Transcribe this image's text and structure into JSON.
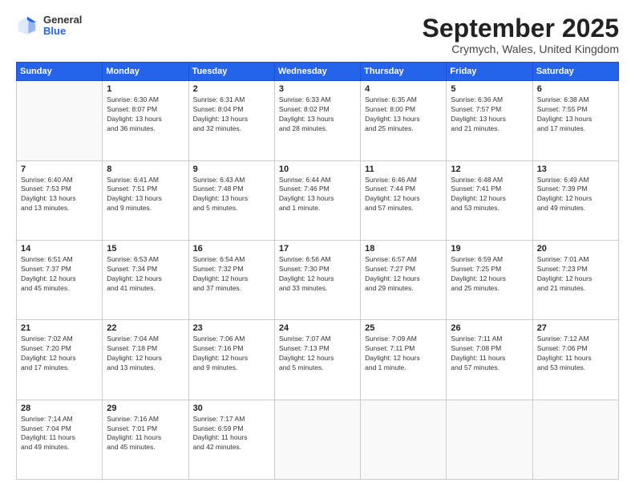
{
  "header": {
    "logo": {
      "general": "General",
      "blue": "Blue"
    },
    "title": "September 2025",
    "location": "Crymych, Wales, United Kingdom"
  },
  "weekdays": [
    "Sunday",
    "Monday",
    "Tuesday",
    "Wednesday",
    "Thursday",
    "Friday",
    "Saturday"
  ],
  "weeks": [
    [
      {
        "day": "",
        "info": ""
      },
      {
        "day": "1",
        "info": "Sunrise: 6:30 AM\nSunset: 8:07 PM\nDaylight: 13 hours\nand 36 minutes."
      },
      {
        "day": "2",
        "info": "Sunrise: 6:31 AM\nSunset: 8:04 PM\nDaylight: 13 hours\nand 32 minutes."
      },
      {
        "day": "3",
        "info": "Sunrise: 6:33 AM\nSunset: 8:02 PM\nDaylight: 13 hours\nand 28 minutes."
      },
      {
        "day": "4",
        "info": "Sunrise: 6:35 AM\nSunset: 8:00 PM\nDaylight: 13 hours\nand 25 minutes."
      },
      {
        "day": "5",
        "info": "Sunrise: 6:36 AM\nSunset: 7:57 PM\nDaylight: 13 hours\nand 21 minutes."
      },
      {
        "day": "6",
        "info": "Sunrise: 6:38 AM\nSunset: 7:55 PM\nDaylight: 13 hours\nand 17 minutes."
      }
    ],
    [
      {
        "day": "7",
        "info": "Sunrise: 6:40 AM\nSunset: 7:53 PM\nDaylight: 13 hours\nand 13 minutes."
      },
      {
        "day": "8",
        "info": "Sunrise: 6:41 AM\nSunset: 7:51 PM\nDaylight: 13 hours\nand 9 minutes."
      },
      {
        "day": "9",
        "info": "Sunrise: 6:43 AM\nSunset: 7:48 PM\nDaylight: 13 hours\nand 5 minutes."
      },
      {
        "day": "10",
        "info": "Sunrise: 6:44 AM\nSunset: 7:46 PM\nDaylight: 13 hours\nand 1 minute."
      },
      {
        "day": "11",
        "info": "Sunrise: 6:46 AM\nSunset: 7:44 PM\nDaylight: 12 hours\nand 57 minutes."
      },
      {
        "day": "12",
        "info": "Sunrise: 6:48 AM\nSunset: 7:41 PM\nDaylight: 12 hours\nand 53 minutes."
      },
      {
        "day": "13",
        "info": "Sunrise: 6:49 AM\nSunset: 7:39 PM\nDaylight: 12 hours\nand 49 minutes."
      }
    ],
    [
      {
        "day": "14",
        "info": "Sunrise: 6:51 AM\nSunset: 7:37 PM\nDaylight: 12 hours\nand 45 minutes."
      },
      {
        "day": "15",
        "info": "Sunrise: 6:53 AM\nSunset: 7:34 PM\nDaylight: 12 hours\nand 41 minutes."
      },
      {
        "day": "16",
        "info": "Sunrise: 6:54 AM\nSunset: 7:32 PM\nDaylight: 12 hours\nand 37 minutes."
      },
      {
        "day": "17",
        "info": "Sunrise: 6:56 AM\nSunset: 7:30 PM\nDaylight: 12 hours\nand 33 minutes."
      },
      {
        "day": "18",
        "info": "Sunrise: 6:57 AM\nSunset: 7:27 PM\nDaylight: 12 hours\nand 29 minutes."
      },
      {
        "day": "19",
        "info": "Sunrise: 6:59 AM\nSunset: 7:25 PM\nDaylight: 12 hours\nand 25 minutes."
      },
      {
        "day": "20",
        "info": "Sunrise: 7:01 AM\nSunset: 7:23 PM\nDaylight: 12 hours\nand 21 minutes."
      }
    ],
    [
      {
        "day": "21",
        "info": "Sunrise: 7:02 AM\nSunset: 7:20 PM\nDaylight: 12 hours\nand 17 minutes."
      },
      {
        "day": "22",
        "info": "Sunrise: 7:04 AM\nSunset: 7:18 PM\nDaylight: 12 hours\nand 13 minutes."
      },
      {
        "day": "23",
        "info": "Sunrise: 7:06 AM\nSunset: 7:16 PM\nDaylight: 12 hours\nand 9 minutes."
      },
      {
        "day": "24",
        "info": "Sunrise: 7:07 AM\nSunset: 7:13 PM\nDaylight: 12 hours\nand 5 minutes."
      },
      {
        "day": "25",
        "info": "Sunrise: 7:09 AM\nSunset: 7:11 PM\nDaylight: 12 hours\nand 1 minute."
      },
      {
        "day": "26",
        "info": "Sunrise: 7:11 AM\nSunset: 7:08 PM\nDaylight: 11 hours\nand 57 minutes."
      },
      {
        "day": "27",
        "info": "Sunrise: 7:12 AM\nSunset: 7:06 PM\nDaylight: 11 hours\nand 53 minutes."
      }
    ],
    [
      {
        "day": "28",
        "info": "Sunrise: 7:14 AM\nSunset: 7:04 PM\nDaylight: 11 hours\nand 49 minutes."
      },
      {
        "day": "29",
        "info": "Sunrise: 7:16 AM\nSunset: 7:01 PM\nDaylight: 11 hours\nand 45 minutes."
      },
      {
        "day": "30",
        "info": "Sunrise: 7:17 AM\nSunset: 6:59 PM\nDaylight: 11 hours\nand 42 minutes."
      },
      {
        "day": "",
        "info": ""
      },
      {
        "day": "",
        "info": ""
      },
      {
        "day": "",
        "info": ""
      },
      {
        "day": "",
        "info": ""
      }
    ]
  ]
}
